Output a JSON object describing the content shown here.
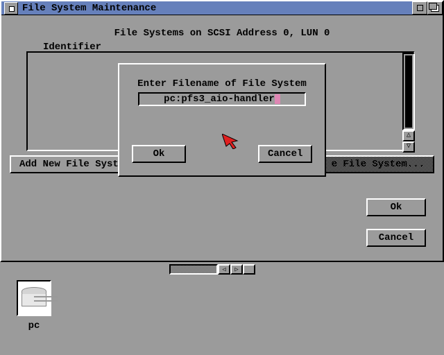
{
  "window": {
    "title": "File System Maintenance",
    "subtitle": "File Systems on  SCSI  Address 0, LUN 0"
  },
  "panel": {
    "label": "Identifier"
  },
  "buttons": {
    "add": "Add New File Syst",
    "update": "e File System...",
    "ok": "Ok",
    "cancel": "Cancel"
  },
  "modal": {
    "label": "Enter Filename of File System",
    "value": "pc:pfs3_aio-handler",
    "ok": "Ok",
    "cancel": "Cancel"
  },
  "scroll": {
    "up": "△",
    "down": "▽",
    "left": "◁",
    "right": "▷"
  },
  "desktop": {
    "pc_label": "pc"
  }
}
